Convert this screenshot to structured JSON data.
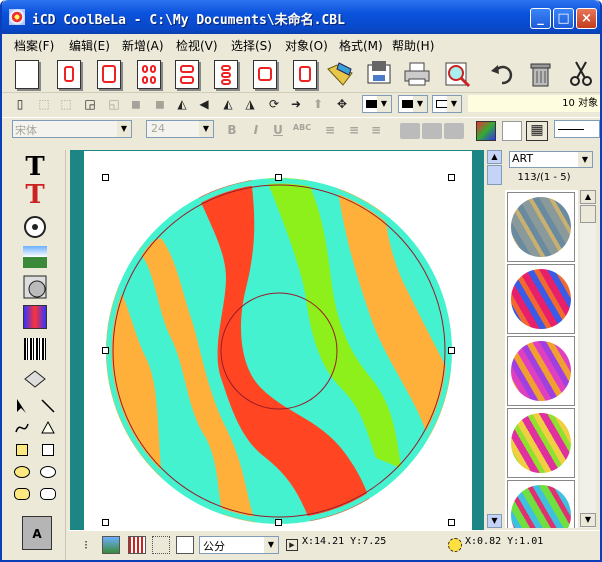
{
  "window": {
    "title": "iCD CoolBeLa - C:\\My Documents\\未命名.CBL",
    "btn_min": "_",
    "btn_max": "□",
    "btn_close": "×"
  },
  "menu": [
    "档案(F)",
    "编辑(E)",
    "新增(A)",
    "检视(V)",
    "选择(S)",
    "对象(O)",
    "格式(M)",
    "帮助(H)"
  ],
  "toolbar2": {
    "object_count": "10 对象"
  },
  "format": {
    "font": "宋体",
    "size": "24",
    "bold": "B",
    "italic": "I",
    "underline": "U",
    "abc": "ABC"
  },
  "lefttools": {
    "text_icon": "T",
    "text_icon2": "T",
    "preview_label": "A"
  },
  "art_panel": {
    "category": "ART",
    "page_info": "113/(1 - 5)"
  },
  "status": {
    "unit": "公分",
    "cursor": "X:14.21 Y:7.25",
    "position": "X:0.82 Y:1.01"
  },
  "colors": {
    "accent": "#0a52dd",
    "frame": "#1e8585",
    "disc_red": "#ff4522",
    "disc_cyan": "#44f2cf",
    "disc_orange": "#ffb03b",
    "disc_green": "#8ef01b"
  }
}
